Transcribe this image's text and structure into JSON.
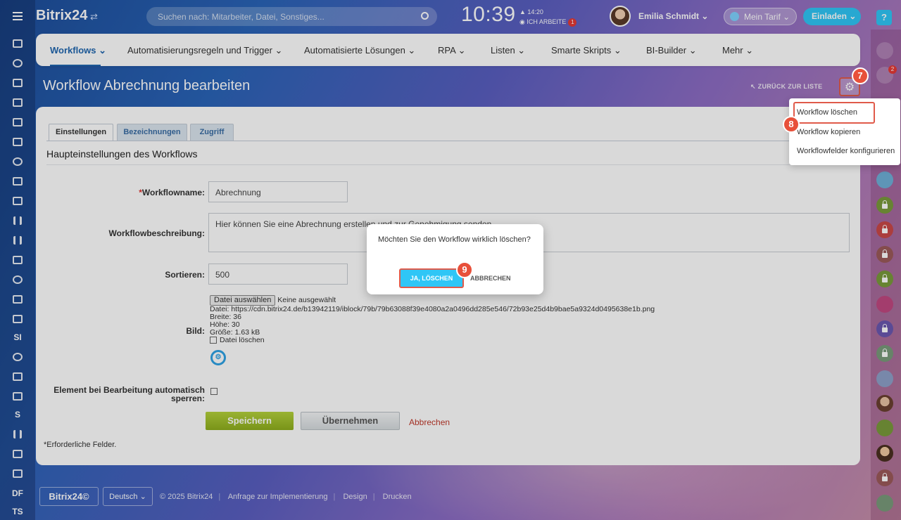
{
  "header": {
    "logo": "Bitrix24",
    "logo_sub": "⇄",
    "search_placeholder": "Suchen nach: Mitarbeiter, Datei, Sonstiges...",
    "clock": "10:39",
    "clock_small": "▲ 14:20",
    "status": "◉ ICH ARBEITE",
    "status_badge": "1",
    "user_name": "Emilia Schmidt ⌄",
    "tarif": "Mein Tarif ⌄",
    "invite": "Einladen ⌄",
    "help": "?"
  },
  "leftbar": {
    "items": [
      "SI",
      "S",
      "DF",
      "TS"
    ]
  },
  "rightbar": {
    "bell_badge": "2"
  },
  "nav": {
    "items": [
      "Workflows ⌄",
      "Automatisierungsregeln und Trigger ⌄",
      "Automatisierte Lösungen ⌄",
      "RPA ⌄",
      "Listen ⌄",
      "Smarte Skripts ⌄",
      "BI-Builder ⌄",
      "Mehr ⌄"
    ]
  },
  "page": {
    "title": "Workflow Abrechnung bearbeiten",
    "back_link": "↖ ZURÜCK ZUR LISTE",
    "gear": "⚙"
  },
  "tabs": [
    "Einstellungen",
    "Bezeichnungen",
    "Zugriff"
  ],
  "form": {
    "section_title": "Haupteinstellungen des Workflows",
    "name_label": "Workflowname:",
    "name_required": "*",
    "name_value": "Abrechnung",
    "desc_label": "Workflowbeschreibung:",
    "desc_value": "Hier können Sie eine Abrechnung erstellen und zur Genehmigung senden.",
    "sort_label": "Sortieren:",
    "sort_value": "500",
    "image_label": "Bild:",
    "file_button": "Datei auswählen",
    "file_none": "Keine ausgewählt",
    "file_path": "Datei: https://cdn.bitrix24.de/b13942119/iblock/79b/79b63088f39e4080a2a0496dd285e546/72b93e25d4b9bae5a9324d0495638e1b.png",
    "file_width": "Breite: 36",
    "file_height": "Höhe: 30",
    "file_size": "Größe: 1.63 kB",
    "file_delete": "Datei löschen",
    "lock_label": "Element bei Bearbeitung automatisch sperren:",
    "save": "Speichern",
    "apply": "Übernehmen",
    "cancel": "Abbrechen",
    "required_note": "*Erforderliche Felder."
  },
  "dropdown": {
    "items": [
      "Workflow löschen",
      "Workflow kopieren",
      "Workflowfelder konfigurieren"
    ]
  },
  "dialog": {
    "text": "Möchten Sie den Workflow wirklich löschen?",
    "yes": "JA, LÖSCHEN",
    "no": "ABBRECHEN"
  },
  "steps": [
    "7",
    "8",
    "9"
  ],
  "footer": {
    "logo": "Bitrix24©",
    "lang": "Deutsch ⌄",
    "copyright": "© 2025 Bitrix24",
    "links": [
      "Anfrage zur Implementierung",
      "Design",
      "Drucken"
    ]
  },
  "colors": {
    "accent": "#2fc6f6",
    "link_blue": "#2067b0",
    "save_green": "#9cbd26",
    "marker_red": "#e8503a"
  }
}
